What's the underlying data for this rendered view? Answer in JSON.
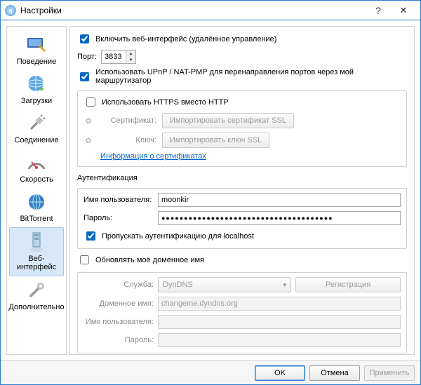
{
  "window": {
    "title": "Настройки",
    "help": "?",
    "close": "✕"
  },
  "sidebar": {
    "items": [
      {
        "label": "Поведение"
      },
      {
        "label": "Загрузки"
      },
      {
        "label": "Соединение"
      },
      {
        "label": "Скорость"
      },
      {
        "label": "BitTorrent"
      },
      {
        "label": "Веб-интерфейс"
      },
      {
        "label": "Дополнительно"
      }
    ]
  },
  "main": {
    "enable_web": {
      "checked": true,
      "label": "Включить веб-интерфейс (удалённое управление)"
    },
    "port": {
      "label": "Порт:",
      "value": "3833"
    },
    "upnp": {
      "checked": true,
      "label": "Использовать UPnP / NAT-PMP для перенаправления портов через мой маршрутизатор"
    },
    "https": {
      "checked": false,
      "label": "Использовать HTTPS вместо HTTP"
    },
    "cert": {
      "label": "Сертификат:",
      "button": "Импортировать сертификат SSL"
    },
    "key": {
      "label": "Ключ:",
      "button": "Импортировать ключ SSL"
    },
    "cert_link": "Информация о сертификатах",
    "auth": {
      "title": "Аутентификация",
      "user_label": "Имя пользователя:",
      "user_value": "moonkir",
      "pass_label": "Пароль:",
      "pass_value": "●●●●●●●●●●●●●●●●●●●●●●●●●●●●●●●●●●●●●●",
      "skip_localhost": {
        "checked": true,
        "label": "Пропускать аутентификацию для localhost"
      }
    },
    "dyndns": {
      "enable": {
        "checked": false,
        "label": "Обновлять моё доменное имя"
      },
      "service_label": "Служба:",
      "service_value": "DynDNS",
      "register": "Регистрация",
      "domain_label": "Доменное имя:",
      "domain_value": "changeme.dyndns.org",
      "user_label": "Имя пользователя:",
      "user_value": "",
      "pass_label": "Пароль:",
      "pass_value": ""
    }
  },
  "footer": {
    "ok": "OK",
    "cancel": "Отмена",
    "apply": "Применить"
  }
}
